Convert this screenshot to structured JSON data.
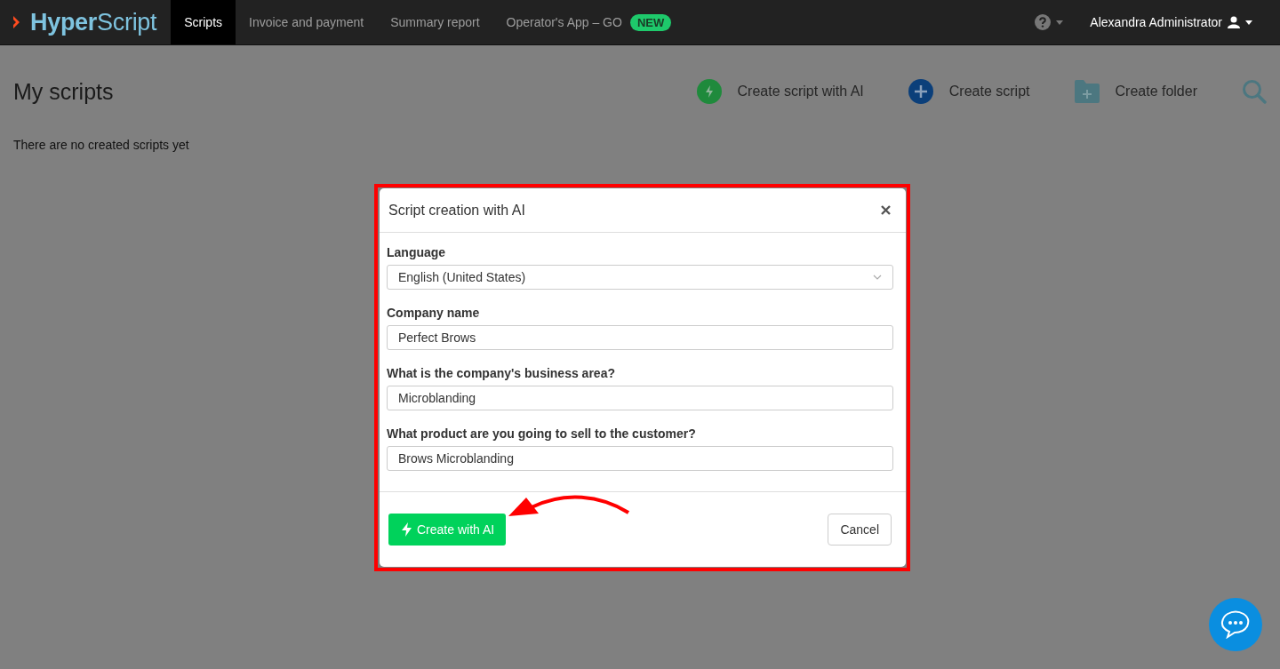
{
  "header": {
    "logo": "**Hyper**Script",
    "nav": [
      {
        "label": "Scripts",
        "selected": true
      },
      {
        "label": "Invoice and payment",
        "selected": false
      },
      {
        "label": "Summary report",
        "selected": false
      },
      {
        "label": "Operator's App – GO",
        "selected": false,
        "badge": "NEW"
      }
    ],
    "user": "Alexandra Administrator"
  },
  "page": {
    "title": "My scripts",
    "actions": [
      {
        "kind": "ai",
        "label": "Create script with AI"
      },
      {
        "kind": "script",
        "label": "Create script"
      },
      {
        "kind": "folder",
        "label": "Create folder"
      }
    ],
    "empty_message": "There are no created scripts yet"
  },
  "dialog": {
    "title": "Script creation with AI",
    "fields": [
      {
        "kind": "select",
        "label": "Language",
        "value": "English (United States)"
      },
      {
        "kind": "text",
        "label": "Company name",
        "value": "Perfect Brows"
      },
      {
        "kind": "text",
        "label": "What is the company's business area?",
        "value": "Microblanding"
      },
      {
        "kind": "text",
        "label": "What product are you going to sell to the customer?",
        "value": "Brows Microblanding"
      }
    ],
    "primary_button": "Create with AI",
    "cancel_button": "Cancel"
  }
}
